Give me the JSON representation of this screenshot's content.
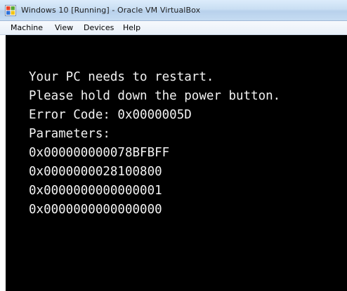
{
  "window": {
    "title": "Windows 10 [Running] - Oracle VM VirtualBox",
    "icon": "virtualbox-icon"
  },
  "menu": {
    "items": [
      "Machine",
      "View",
      "Devices",
      "Help"
    ]
  },
  "screen": {
    "background": "#000000",
    "text_color": "#f2f2f2",
    "lines": [
      "Your PC needs to restart.",
      "Please hold down the power button.",
      "Error Code: 0x0000005D",
      "Parameters:",
      "0x000000000078BFBFF",
      "0x0000000028100800",
      "0x0000000000000001",
      "0x0000000000000000"
    ]
  }
}
